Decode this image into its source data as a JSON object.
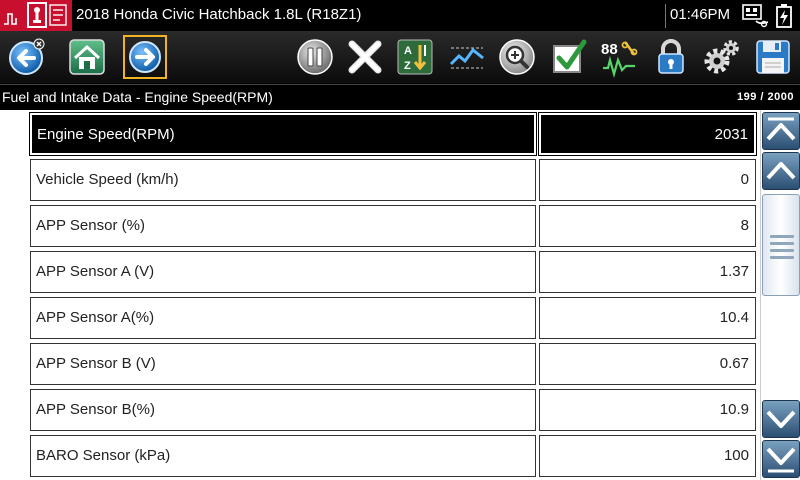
{
  "header": {
    "title": "2018 Honda Civic Hatchback 1.8L (R18Z1)",
    "time": "01:46PM"
  },
  "toolbar": {
    "buttons": [
      {
        "name": "back",
        "icon": "back-arrow-icon"
      },
      {
        "name": "home",
        "icon": "home-icon"
      },
      {
        "name": "forward",
        "icon": "forward-arrow-icon",
        "selected": true
      },
      {
        "name": "pause",
        "icon": "pause-icon"
      },
      {
        "name": "clear",
        "icon": "x-icon"
      },
      {
        "name": "sort",
        "icon": "sort-az-icon"
      },
      {
        "name": "graph",
        "icon": "graph-icon"
      },
      {
        "name": "zoom",
        "icon": "zoom-icon"
      },
      {
        "name": "select",
        "icon": "checkmark-icon"
      },
      {
        "name": "units",
        "icon": "units-88-icon"
      },
      {
        "name": "lock",
        "icon": "lock-icon"
      },
      {
        "name": "settings",
        "icon": "gear-icon"
      },
      {
        "name": "save",
        "icon": "save-icon"
      }
    ],
    "units_label": "88"
  },
  "subheader": {
    "breadcrumb": "Fuel and Intake Data - Engine Speed(RPM)",
    "counter": "199 / 2000"
  },
  "rows": [
    {
      "name": "Engine Speed(RPM)",
      "value": "2031",
      "selected": true
    },
    {
      "name": "Vehicle Speed (km/h)",
      "value": "0"
    },
    {
      "name": "APP Sensor (%)",
      "value": "8"
    },
    {
      "name": "APP Sensor A (V)",
      "value": "1.37"
    },
    {
      "name": "APP Sensor A(%)",
      "value": "10.4"
    },
    {
      "name": "APP Sensor B (V)",
      "value": "0.67"
    },
    {
      "name": "APP Sensor B(%)",
      "value": "10.9"
    },
    {
      "name": "BARO Sensor (kPa)",
      "value": "100"
    }
  ],
  "colors": {
    "brand_red": "#c8102e",
    "selection_outline": "#f0b323",
    "selected_row_bg": "#000000"
  }
}
